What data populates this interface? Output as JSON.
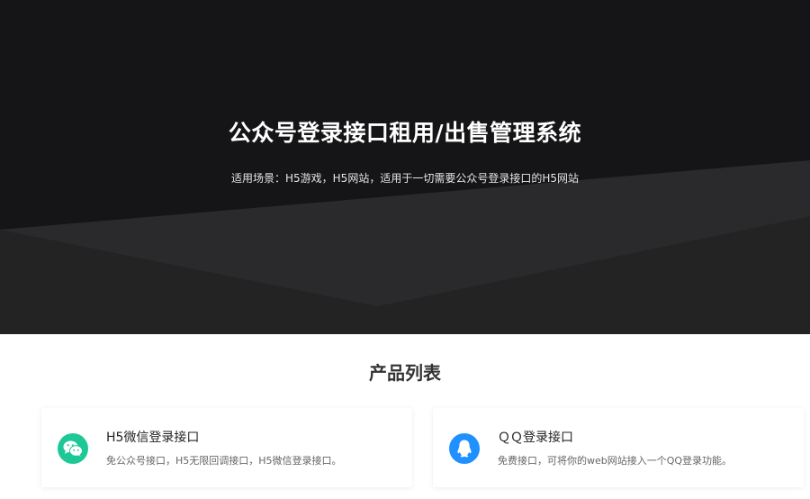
{
  "hero": {
    "title_parts": [
      "公众号登录",
      "接口",
      "租",
      "用",
      "/出售管理系统"
    ],
    "subtitle": "适用场景：H5游戏，H5网站，适用于一切需要公众号登录接口的H5网站"
  },
  "products": {
    "section_title": "产品列表",
    "items": [
      {
        "name": "H5微信登录接口",
        "description": "免公众号接口，H5无限回调接口，H5微信登录接口。",
        "icon": "wechat-icon",
        "icon_color": "#1ec896"
      },
      {
        "name": "ＱＱ登录接口",
        "description": "免费接口，可将你的web网站接入一个QQ登录功能。",
        "icon": "qq-icon",
        "icon_color": "#1e90ff"
      }
    ]
  }
}
